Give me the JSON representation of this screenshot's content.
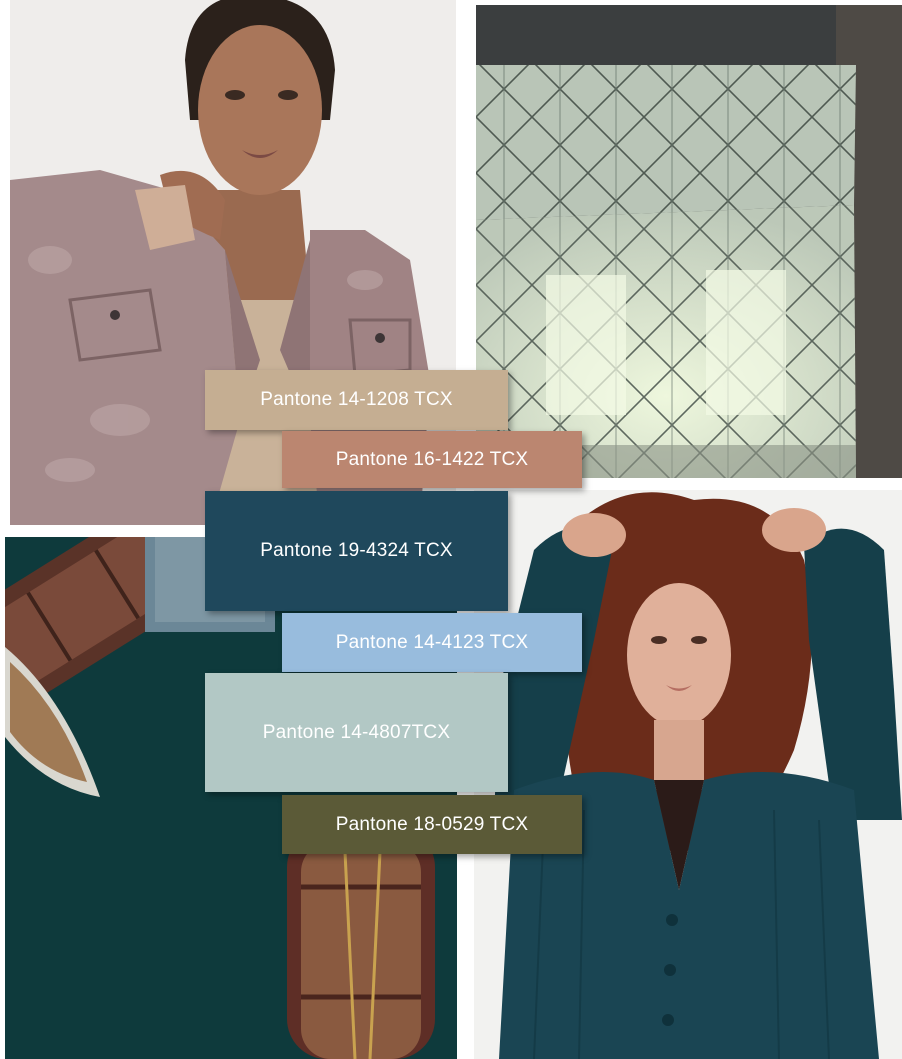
{
  "photos": [
    {
      "name": "woman-denim-jacket",
      "background": "#efedeb"
    },
    {
      "name": "geometric-pattern-lamp",
      "background": "#3c3f40"
    },
    {
      "name": "wooden-boats-aerial",
      "background": "#0d3a3c"
    },
    {
      "name": "woman-teal-cardigan",
      "background": "#f2f2f0"
    }
  ],
  "swatches": [
    {
      "label": "Pantone 14-1208 TCX",
      "color": "#c5ae92"
    },
    {
      "label": "Pantone 16-1422 TCX",
      "color": "#bb8670"
    },
    {
      "label": "Pantone 19-4324 TCX",
      "color": "#1f485c"
    },
    {
      "label": "Pantone 14-4123 TCX",
      "color": "#98bcdd"
    },
    {
      "label": "Pantone 14-4807TCX",
      "color": "#b2c8c5"
    },
    {
      "label": "Pantone 18-0529 TCX",
      "color": "#5b5a37"
    }
  ]
}
